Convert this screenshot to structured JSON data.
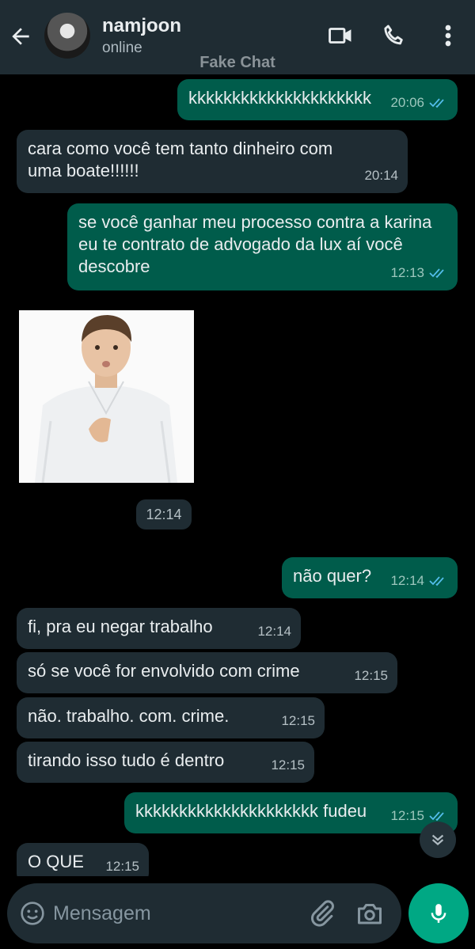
{
  "header": {
    "contact_name": "namjoon",
    "contact_status": "online",
    "icons": [
      "back-arrow",
      "video-call",
      "voice-call",
      "more-vertical"
    ]
  },
  "watermark": "Fake Chat",
  "messages": [
    {
      "dir": "out",
      "text": "kkkkkkkkkkkkkkkkkkkkk",
      "time": "20:06",
      "read": true
    },
    {
      "dir": "in",
      "text": "cara como você tem tanto dinheiro com uma boate!!!!!!",
      "time": "20:14"
    },
    {
      "dir": "out",
      "text": "se você ganhar meu processo contra a karina eu te contrato de advogado da lux aí você descobre",
      "time": "12:13",
      "read": true
    },
    {
      "dir": "in",
      "type": "image",
      "time": "12:14"
    },
    {
      "dir": "out",
      "text": "não quer?",
      "time": "12:14",
      "read": true
    },
    {
      "dir": "in",
      "text": "fi, pra eu negar trabalho",
      "time": "12:14"
    },
    {
      "dir": "in",
      "text": "só se você for envolvido com crime",
      "time": "12:15"
    },
    {
      "dir": "in",
      "text": "não. trabalho. com. crime.",
      "time": "12:15"
    },
    {
      "dir": "in",
      "text": "tirando isso tudo é dentro",
      "time": "12:15"
    },
    {
      "dir": "out",
      "text": "kkkkkkkkkkkkkkkkkkkkk fudeu",
      "time": "12:15",
      "read": true
    },
    {
      "dir": "in",
      "text": "O QUE",
      "time": "12:15"
    }
  ],
  "composer": {
    "placeholder": "Mensagem"
  },
  "colors": {
    "header_bg": "#1f2c33",
    "incoming_bubble": "#1f2c33",
    "outgoing_bubble": "#005c4b",
    "read_tick": "#53bdeb",
    "accent": "#00a884"
  }
}
